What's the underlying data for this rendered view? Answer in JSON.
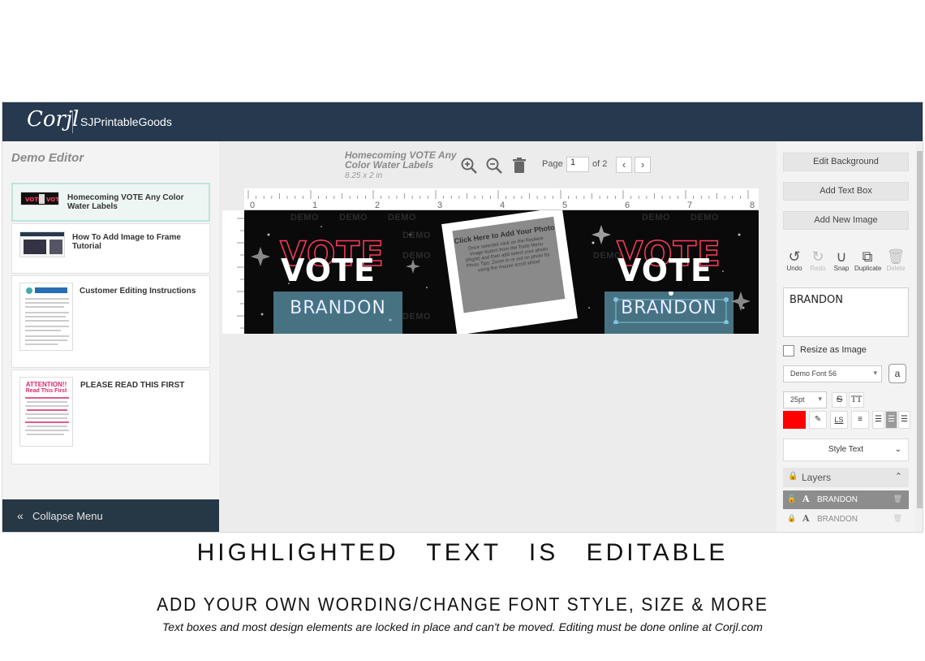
{
  "app": {
    "logo": "Corjl",
    "shop_name": "SJPrintableGoods"
  },
  "sidebar": {
    "title": "Demo Editor",
    "items": [
      {
        "label": "Homecoming VOTE Any Color Water Labels",
        "active": true
      },
      {
        "label": "How To Add Image to Frame Tutorial",
        "active": false
      },
      {
        "label": "Customer Editing Instructions",
        "active": false
      },
      {
        "label": "PLEASE READ THIS FIRST",
        "active": false
      }
    ],
    "attention_thumb": {
      "title": "ATTENTION!!",
      "subtitle": "Read This First"
    },
    "collapse_label": "Collapse Menu"
  },
  "center": {
    "doc_title": "Homecoming VOTE Any Color Water Labels",
    "doc_size": "8.25 x 2 in",
    "page_label": "Page",
    "page_value": "1",
    "page_of": "of 2",
    "ruler_numbers": [
      "0",
      "1",
      "2",
      "3",
      "4",
      "5",
      "6",
      "7",
      "8"
    ]
  },
  "canvas": {
    "vote_text": "VOTE",
    "name_text": "BRANDON",
    "demo_watermark": "DEMO",
    "photo_title": "Click Here to Add Your Photo",
    "photo_hint": "Once selected click on the Replace Image button from the Tools Menu (Right) and then add select your photo. Photo Tips: Zoom in or out on photo by using the mouse scroll wheel"
  },
  "right_panel": {
    "edit_background": "Edit Background",
    "add_text_box": "Add Text Box",
    "add_new_image": "Add New Image",
    "actions": [
      {
        "label": "Undo",
        "enabled": true
      },
      {
        "label": "Redo",
        "enabled": false
      },
      {
        "label": "Snap",
        "enabled": true
      },
      {
        "label": "Duplicate",
        "enabled": true
      },
      {
        "label": "Delete",
        "enabled": false
      }
    ],
    "text_value": "BRANDON",
    "resize_as_image": "Resize as Image",
    "font": "Demo Font 56",
    "font_size": "25pt",
    "text_color": "#ff0000",
    "style_text": "Style Text",
    "layers_title": "Layers",
    "layers": [
      {
        "name": "BRANDON",
        "selected": true
      },
      {
        "name": "BRANDON",
        "selected": false
      }
    ]
  },
  "captions": {
    "line1": "HIGHLIGHTED TEXT IS EDITABLE",
    "line2": "ADD YOUR OWN WORDING/CHANGE FONT STYLE, SIZE & MORE",
    "line3": "Text boxes and most design elements are locked in place and can't be moved. Editing must be done online at Corjl.com"
  }
}
